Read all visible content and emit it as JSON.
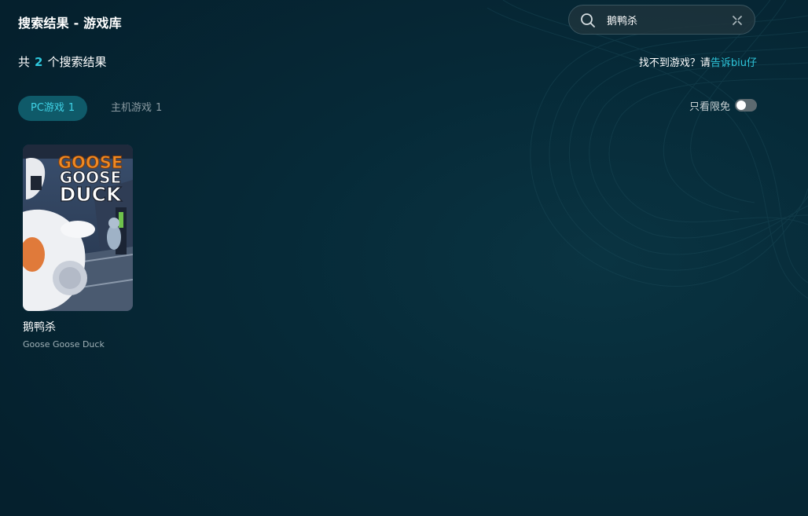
{
  "header": {
    "title": "搜索结果 - 游戏库"
  },
  "search": {
    "value": "鹅鸭杀",
    "placeholder": ""
  },
  "summary": {
    "prefix": "共",
    "count": "2",
    "suffix": "个搜索结果"
  },
  "feedback": {
    "text": "找不到游戏？请",
    "link": "告诉biu仔"
  },
  "tabs": [
    {
      "label": "PC游戏",
      "count": "1",
      "active": true
    },
    {
      "label": "主机游戏",
      "count": "1",
      "active": false
    }
  ],
  "filter": {
    "free_only_label": "只看限免",
    "free_only_enabled": false
  },
  "results": [
    {
      "name": "鹅鸭杀",
      "subtitle": "Goose Goose Duck",
      "cover_text": [
        "GOOSE",
        "GOOSE",
        "DUCK"
      ]
    }
  ],
  "colors": {
    "accent": "#2ec7dc",
    "active_tab_bg": "#0f5a69",
    "background": "#062a38"
  },
  "icons": {
    "search": "search-icon",
    "clear": "clear-icon",
    "toggle": "toggle-switch"
  }
}
